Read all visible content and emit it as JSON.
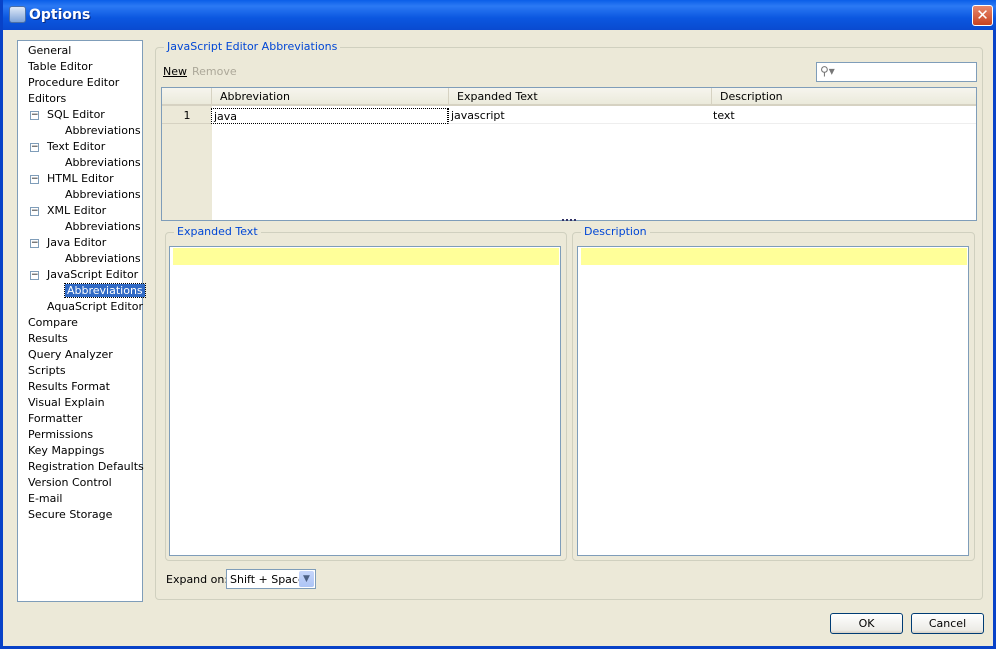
{
  "window": {
    "title": "Options",
    "close": "✕"
  },
  "tree": [
    {
      "label": "General",
      "level": 0
    },
    {
      "label": "Table Editor",
      "level": 0
    },
    {
      "label": "Procedure Editor",
      "level": 0
    },
    {
      "label": "Editors",
      "level": 0
    },
    {
      "label": "SQL Editor",
      "level": 1,
      "expander": "−"
    },
    {
      "label": "Abbreviations",
      "level": 2
    },
    {
      "label": "Text Editor",
      "level": 1,
      "expander": "−"
    },
    {
      "label": "Abbreviations",
      "level": 2
    },
    {
      "label": "HTML Editor",
      "level": 1,
      "expander": "−"
    },
    {
      "label": "Abbreviations",
      "level": 2
    },
    {
      "label": "XML Editor",
      "level": 1,
      "expander": "−"
    },
    {
      "label": "Abbreviations",
      "level": 2
    },
    {
      "label": "Java Editor",
      "level": 1,
      "expander": "−"
    },
    {
      "label": "Abbreviations",
      "level": 2
    },
    {
      "label": "JavaScript Editor",
      "level": 1,
      "expander": "−"
    },
    {
      "label": "Abbreviations",
      "level": 2,
      "selected": true
    },
    {
      "label": "AquaScript Editor",
      "level": 1
    },
    {
      "label": "Compare",
      "level": 0
    },
    {
      "label": "Results",
      "level": 0
    },
    {
      "label": "Query Analyzer",
      "level": 0
    },
    {
      "label": "Scripts",
      "level": 0
    },
    {
      "label": "Results Format",
      "level": 0
    },
    {
      "label": "Visual Explain",
      "level": 0
    },
    {
      "label": "Formatter",
      "level": 0
    },
    {
      "label": "Permissions",
      "level": 0
    },
    {
      "label": "Key Mappings",
      "level": 0
    },
    {
      "label": "Registration Defaults",
      "level": 0
    },
    {
      "label": "Version Control",
      "level": 0
    },
    {
      "label": "E-mail",
      "level": 0
    },
    {
      "label": "Secure Storage",
      "level": 0
    }
  ],
  "main": {
    "group_title": "JavaScript Editor Abbreviations",
    "new_label": "New",
    "remove_label": "Remove",
    "search": {
      "value": "",
      "icon": "search-icon"
    },
    "columns": [
      "Abbreviation",
      "Expanded Text",
      "Description"
    ],
    "rows": [
      {
        "num": "1",
        "abbreviation": "java",
        "expanded": "javascript",
        "description": "text"
      }
    ],
    "expanded_title": "Expanded Text",
    "description_title": "Description",
    "expand_on_label": "Expand on:",
    "expand_on_value": "Shift + Space"
  },
  "buttons": {
    "ok": "OK",
    "cancel": "Cancel"
  },
  "colors": {
    "accent": "#316ac5",
    "group_label": "#0046d5",
    "highlight": "#ffff99"
  }
}
